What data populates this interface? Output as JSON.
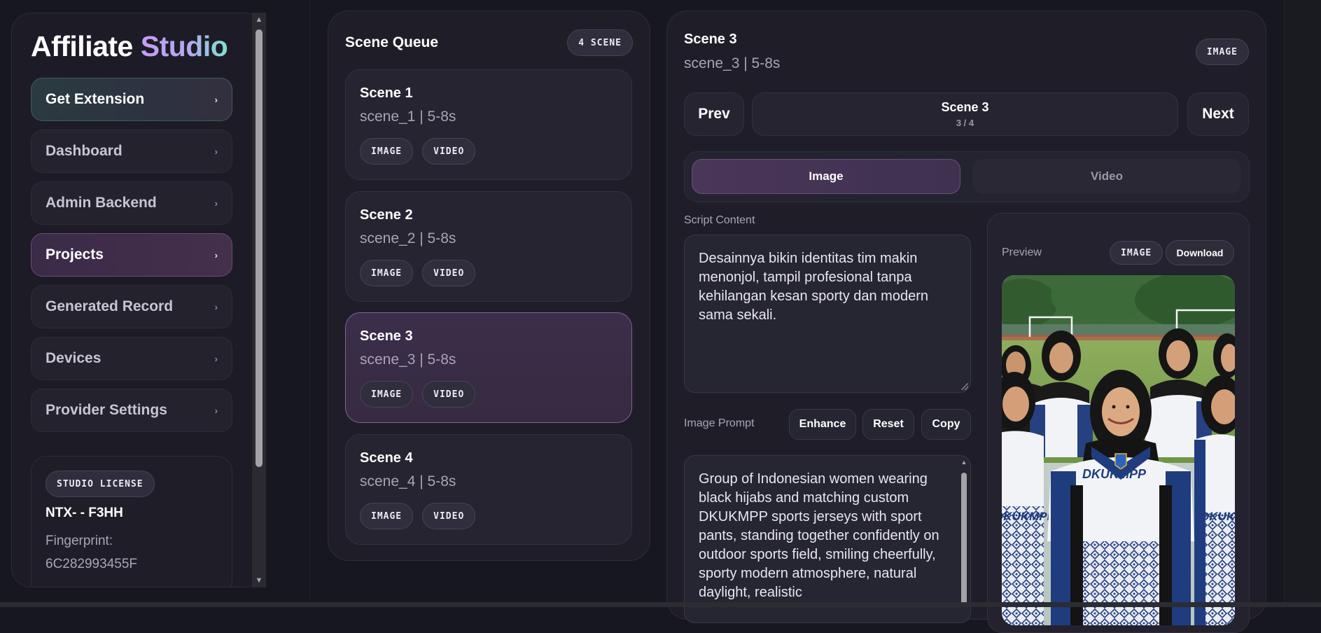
{
  "sidebar": {
    "brand_primary": "Affiliate",
    "brand_accent": "Studio",
    "items": [
      {
        "label": "Get Extension"
      },
      {
        "label": "Dashboard"
      },
      {
        "label": "Admin Backend"
      },
      {
        "label": "Projects"
      },
      {
        "label": "Generated Record"
      },
      {
        "label": "Devices"
      },
      {
        "label": "Provider Settings"
      }
    ],
    "chevron_icon": "chevron-right-icon",
    "license": {
      "badge": "STUDIO LICENSE",
      "key": "NTX- - F3HH",
      "fingerprint_label": "Fingerprint:",
      "fingerprint_value": "6C282993455F"
    }
  },
  "queue": {
    "title": "Scene Queue",
    "count_badge": "4 SCENE",
    "scenes": [
      {
        "title": "Scene 1",
        "subtitle": "scene_1 | 5-8s",
        "tags": [
          "IMAGE",
          "VIDEO"
        ]
      },
      {
        "title": "Scene 2",
        "subtitle": "scene_2 | 5-8s",
        "tags": [
          "IMAGE",
          "VIDEO"
        ]
      },
      {
        "title": "Scene 3",
        "subtitle": "scene_3 | 5-8s",
        "tags": [
          "IMAGE",
          "VIDEO"
        ]
      },
      {
        "title": "Scene 4",
        "subtitle": "scene_4 | 5-8s",
        "tags": [
          "IMAGE",
          "VIDEO"
        ]
      }
    ],
    "selected_scene": "Scene 3"
  },
  "detail": {
    "title": "Scene 3",
    "subtitle": "scene_3 | 5-8s",
    "type_badge": "IMAGE",
    "prev_label": "Prev",
    "next_label": "Next",
    "indicator_title": "Scene 3",
    "indicator_position": "3 / 4",
    "tabs": [
      {
        "label": "Image",
        "active": true
      },
      {
        "label": "Video",
        "active": false
      }
    ],
    "script_label": "Script Content",
    "script_text": "Desainnya bikin identitas tim makin menonjol, tampil profesional tanpa kehilangan kesan sporty dan modern sama sekali.",
    "prompt_label": "Image Prompt",
    "buttons": {
      "enhance": "Enhance",
      "reset": "Reset",
      "copy": "Copy"
    },
    "prompt_text": "Group of Indonesian women wearing black hijabs and matching custom DKUKMPP sports jerseys with sport pants, standing together confidently on outdoor sports field, smiling cheerfully, sporty modern atmosphere, natural daylight, realistic",
    "preview": {
      "label": "Preview",
      "badge": "IMAGE",
      "download_label": "Download",
      "jersey_text": "DKUKMPP"
    }
  },
  "colors": {
    "background": "#17171f",
    "panel": "#1f1e28",
    "accent_purple": "#8a5f99",
    "brand_gradient_start": "#c79cf5",
    "brand_gradient_end": "#7fe1d2",
    "jersey_navy": "#1f3c7e"
  }
}
